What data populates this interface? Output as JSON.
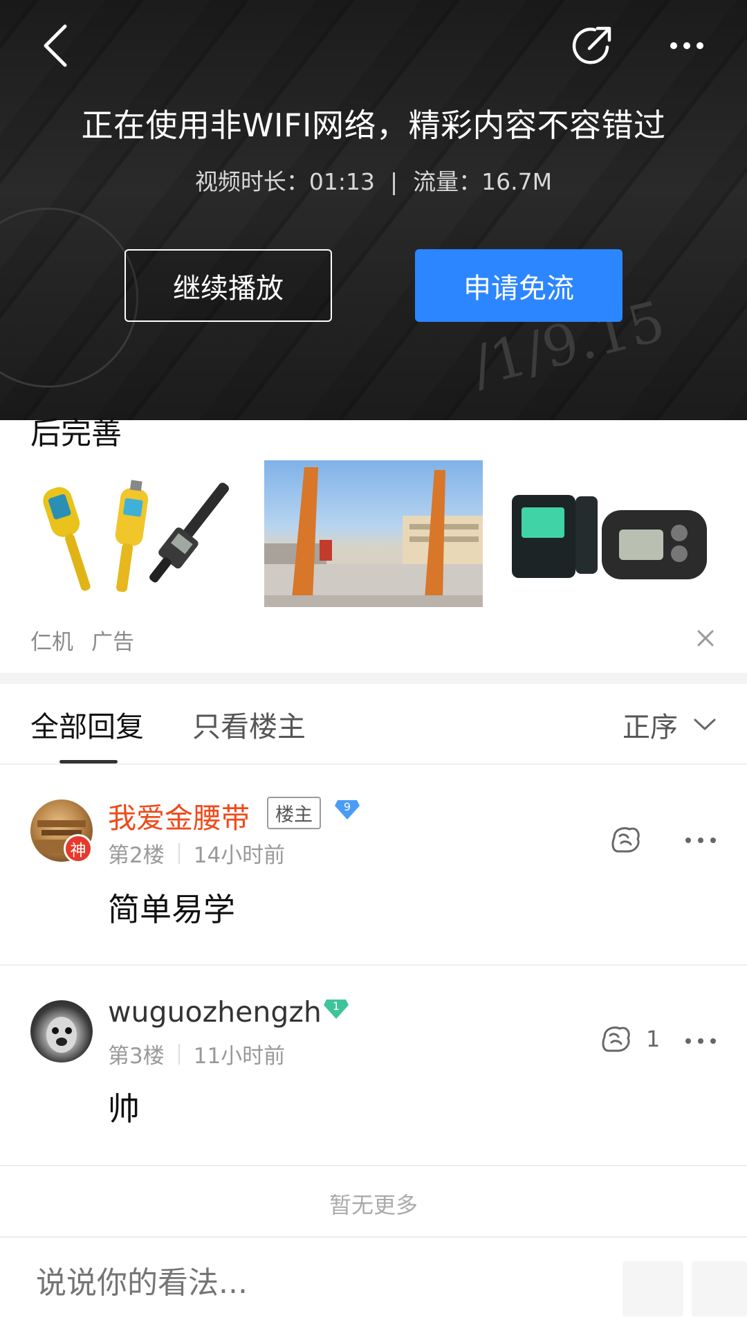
{
  "overlay": {
    "title": "正在使用非WIFI网络，精彩内容不容错过",
    "duration_label": "视频时长：01:13",
    "separator": "|",
    "traffic_label": "流量：16.7M",
    "continue_button": "继续播放",
    "free_button": "申请免流"
  },
  "ad": {
    "text": "后完善",
    "source": "仁机",
    "tag": "广告"
  },
  "tabs": {
    "all": "全部回复",
    "owner_only": "只看楼主",
    "sort": "正序"
  },
  "comments": [
    {
      "username": "我爱金腰带",
      "owner_tag": "楼主",
      "level": "9",
      "badge": "神",
      "floor": "第2楼",
      "time": "14小时前",
      "content": "简单易学",
      "likes": ""
    },
    {
      "username": "wuguozhengzh",
      "level": "1",
      "floor": "第3楼",
      "time": "11小时前",
      "content": "帅",
      "likes": "1"
    }
  ],
  "footer": {
    "no_more": "暂无更多",
    "input_placeholder": "说说你的看法..."
  },
  "colors": {
    "accent_blue": "#2b86ff",
    "username_red": "#f04a1a",
    "level_blue": "#4a9cf5",
    "level_green": "#3ec49a"
  }
}
